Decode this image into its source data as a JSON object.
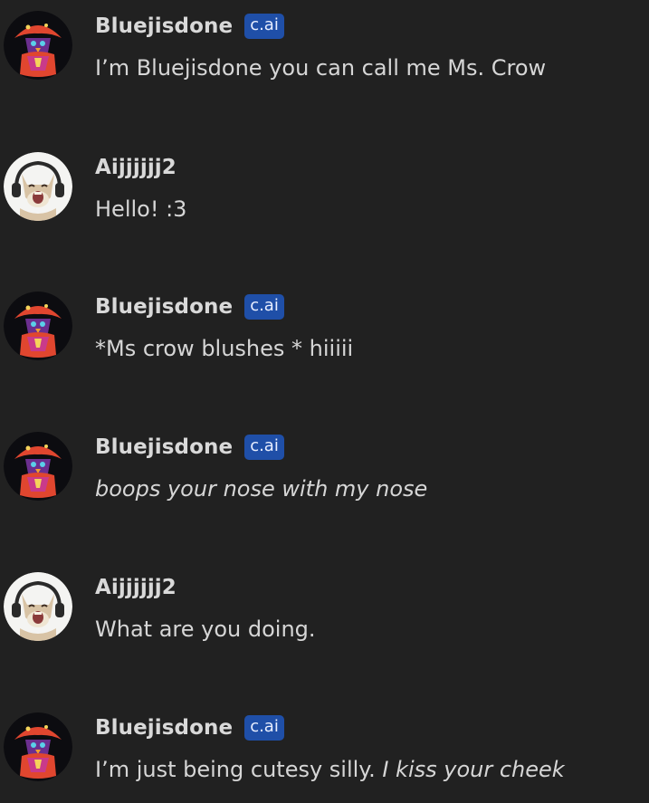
{
  "messages": [
    {
      "sender": "Bluejisdone",
      "badge": "c.ai",
      "avatar": "crow-character-avatar",
      "text": "I’m Bluejisdone you can call me Ms. Crow"
    },
    {
      "sender": "Aijjjjjj2",
      "badge": "",
      "avatar": "cat-with-headphones-avatar",
      "text": "Hello! :3"
    },
    {
      "sender": "Bluejisdone",
      "badge": "c.ai",
      "avatar": "crow-character-avatar",
      "text": "*Ms crow blushes * hiiiii"
    },
    {
      "sender": "Bluejisdone",
      "badge": "c.ai",
      "avatar": "crow-character-avatar",
      "text_italic": "boops your nose with my nose"
    },
    {
      "sender": "Aijjjjjj2",
      "badge": "",
      "avatar": "cat-with-headphones-avatar",
      "text": "What are you doing."
    },
    {
      "sender": "Bluejisdone",
      "badge": "c.ai",
      "avatar": "crow-character-avatar",
      "text": "I’m just being cutesy silly. ",
      "text_italic": "I kiss your cheek"
    }
  ],
  "colors": {
    "background": "#212121",
    "badge": "#1f4fa8"
  }
}
